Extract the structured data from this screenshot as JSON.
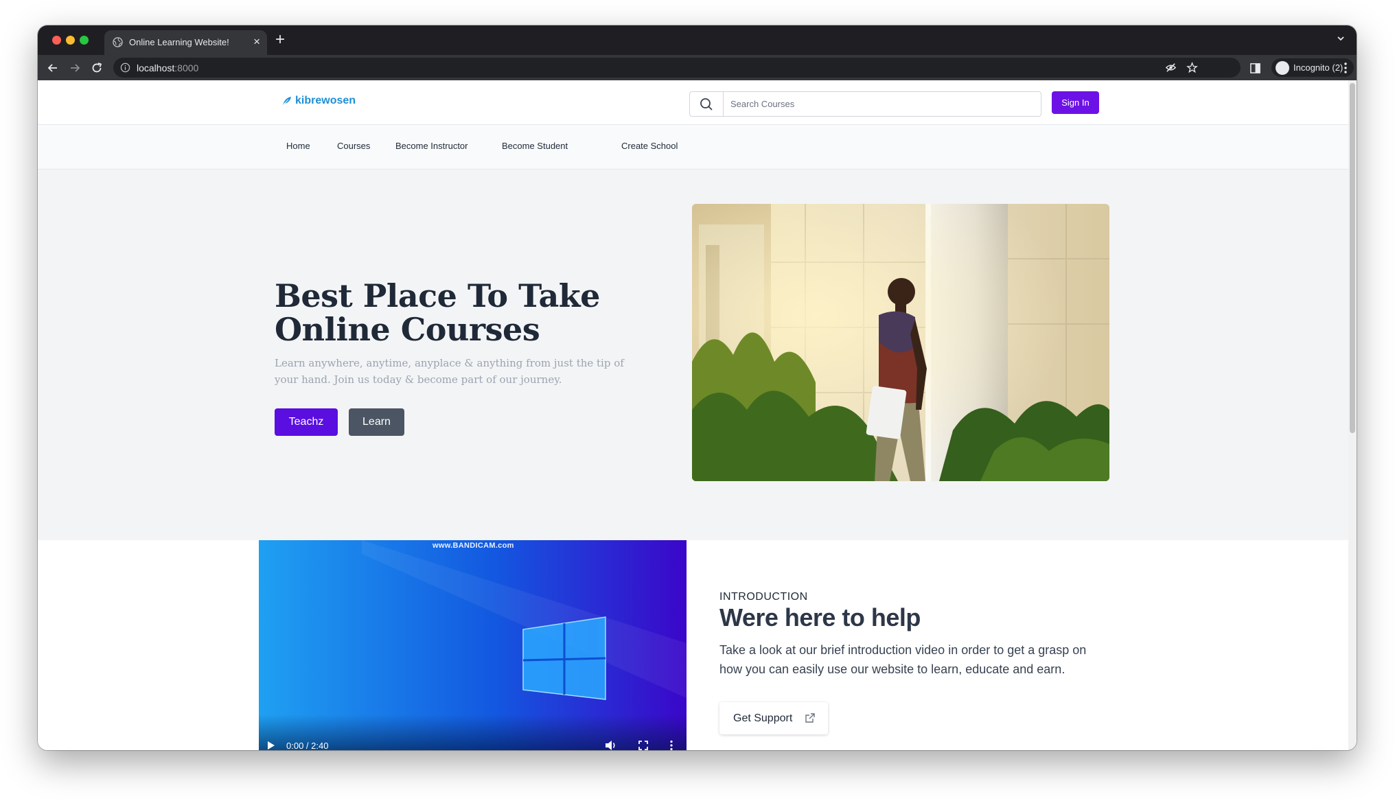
{
  "browser": {
    "tab_title": "Online Learning Website!",
    "url_host": "localhost",
    "url_port": ":8000",
    "incognito_label": "Incognito (2)"
  },
  "header": {
    "logo_text": "kibrewosen",
    "search_placeholder": "Search Courses",
    "signin_label": "Sign In"
  },
  "nav": {
    "items": [
      "Home",
      "Courses",
      "Become Instructor",
      "Become Student",
      "Create School"
    ]
  },
  "hero": {
    "title_line1": "Best Place To Take",
    "title_line2": "Online Courses",
    "subtitle": "Learn anywhere, anytime, anyplace & anything from just the tip of your hand. Join us today & become part of our journey.",
    "primary_button": "Teachz",
    "secondary_button": "Learn"
  },
  "intro": {
    "video_watermark": "www.BANDICAM.com",
    "video_time": "0:00 / 2:40",
    "eyebrow": "INTRODUCTION",
    "title": "Were here to help",
    "text": "Take a look at our brief introduction video in order to get a grasp on how you can easily use our website to learn, educate and earn.",
    "support_button": "Get Support"
  },
  "colors": {
    "brand": "#6d12e6",
    "teachz_button": "#5a0ee0",
    "learn_button": "#4b5563",
    "logo": "#1e8fd6",
    "hero_background": "#f3f4f6"
  },
  "icons": {
    "close_window": "close-window-icon",
    "minimize_window": "minimize-window-icon",
    "maximize_window": "maximize-window-icon",
    "back": "back-arrow-icon",
    "forward": "forward-arrow-icon",
    "reload": "reload-icon",
    "search": "search-icon",
    "external_link": "external-link-icon",
    "play": "play-icon",
    "volume": "volume-icon",
    "fullscreen": "fullscreen-icon"
  }
}
